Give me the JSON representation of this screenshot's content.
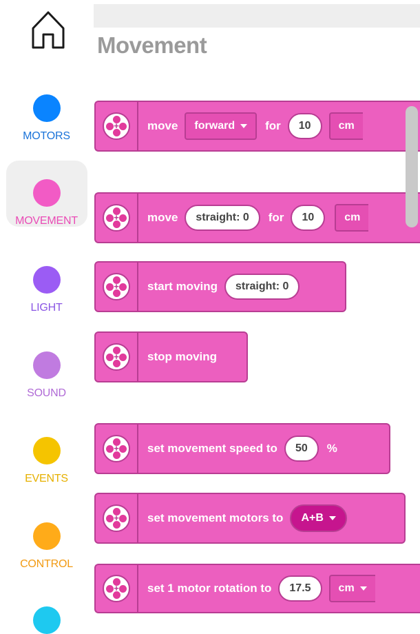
{
  "sidebar": {
    "home_icon": "home-icon",
    "categories": [
      {
        "label": "MOTORS",
        "color": "#0a84ff",
        "label_color": "#1a73d9"
      },
      {
        "label": "MOVEMENT",
        "color": "#f25bc5",
        "label_color": "#ea4cb6",
        "selected": true
      },
      {
        "label": "LIGHT",
        "color": "#9b5cf4",
        "label_color": "#8a55e4"
      },
      {
        "label": "SOUND",
        "color": "#c07be0",
        "label_color": "#b06ad6"
      },
      {
        "label": "EVENTS",
        "color": "#f5c400",
        "label_color": "#e6b000"
      },
      {
        "label": "CONTROL",
        "color": "#ffab19",
        "label_color": "#f29a12"
      },
      {
        "label": "",
        "color": "#1ec9f0"
      }
    ]
  },
  "palette": {
    "title": "Movement",
    "block_color": "#ec5fbf",
    "blocks": [
      {
        "parts": [
          "move",
          "forward",
          "for",
          "10",
          "cm"
        ]
      },
      {
        "parts": [
          "move",
          "straight: 0",
          "for",
          "10",
          "cm"
        ]
      },
      {
        "parts": [
          "start moving",
          "straight: 0"
        ]
      },
      {
        "parts": [
          "stop moving"
        ]
      },
      {
        "parts": [
          "set movement speed to",
          "50",
          "%"
        ]
      },
      {
        "parts": [
          "set movement motors to",
          "A+B"
        ]
      },
      {
        "parts": [
          "set 1 motor rotation to",
          "17.5",
          "cm"
        ]
      }
    ]
  }
}
